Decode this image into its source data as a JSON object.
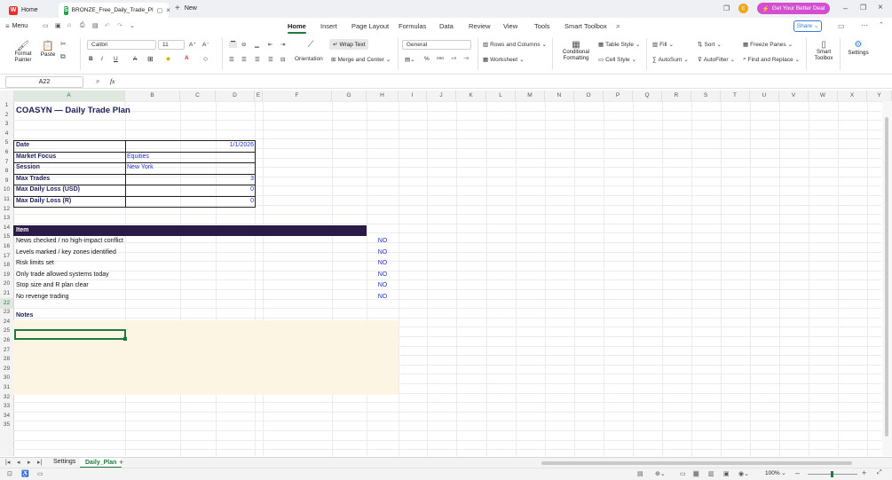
{
  "tabs": {
    "home": "Home",
    "file": "BRONZE_Free_Daily_Trade_Pl",
    "new": "New"
  },
  "topbar": {
    "deal_button": "Get Your Better Deal",
    "avatar_letter": "c"
  },
  "menu": {
    "menu_label": "Menu",
    "tabs": [
      "Home",
      "Insert",
      "Page Layout",
      "Formulas",
      "Data",
      "Review",
      "View",
      "Tools",
      "Smart Toolbox"
    ],
    "share": "Share"
  },
  "ribbon": {
    "format_painter": "Format Painter",
    "paste": "Paste",
    "font_name": "Calibri",
    "font_size": "11",
    "wrap_text": "Wrap Text",
    "orientation": "Orientation",
    "merge_center": "Merge and Center",
    "number_format": "General",
    "rows_columns": "Rows and Columns",
    "worksheet": "Worksheet",
    "conditional_formatting": "Conditional Formatting",
    "table_style": "Table Style",
    "cell_style": "Cell Style",
    "fill": "Fill",
    "autosum": "AutoSum",
    "sort": "Sort",
    "autofilter": "AutoFilter",
    "freeze_panes": "Freeze Panes",
    "find_replace": "Find and Replace",
    "smart_toolbox": "Smart Toolbox",
    "settings": "Settings"
  },
  "formula_bar": {
    "name_box": "A22",
    "fx": "fx",
    "content": ""
  },
  "columns": [
    "A",
    "B",
    "C",
    "D",
    "E",
    "F",
    "G",
    "H",
    "I",
    "J",
    "K",
    "L",
    "M",
    "N",
    "O",
    "P",
    "Q",
    "R",
    "S",
    "T",
    "U",
    "V",
    "W",
    "X",
    "Y"
  ],
  "rows": [
    "1",
    "2",
    "3",
    "4",
    "5",
    "6",
    "7",
    "8",
    "9",
    "10",
    "11",
    "12",
    "13",
    "14",
    "15",
    "16",
    "17",
    "18",
    "19",
    "20",
    "21",
    "22",
    "23",
    "24",
    "25",
    "26",
    "27",
    "28",
    "29",
    "30",
    "31",
    "32",
    "33",
    "34",
    "35"
  ],
  "sheet": {
    "title": "COASYN — Daily Trade Plan",
    "info_labels": [
      "Date",
      "Market Focus",
      "Session",
      "Max Trades",
      "Max Daily Loss (USD)",
      "Max Daily Loss (R)"
    ],
    "info_values": [
      "1/1/2026",
      "Equities",
      "New York",
      "3",
      "0",
      "0"
    ],
    "item_header": "Item",
    "items": [
      "News checked / no high-impact conflict",
      "Levels marked / key zones identified",
      "Risk limits set",
      "Only trade allowed systems today",
      "Stop size and R plan clear",
      "No revenge trading"
    ],
    "item_values": [
      "NO",
      "NO",
      "NO",
      "NO",
      "NO",
      "NO"
    ],
    "notes_label": "Notes"
  },
  "sheet_tabs": [
    "Settings",
    "Daily_Plan"
  ],
  "status": {
    "zoom": "100%"
  },
  "colors": {
    "header_band": "#2a1a47",
    "notes_fill": "#fdf5e4",
    "accent": "#1f7a3d",
    "deal": "#d44fd0"
  }
}
